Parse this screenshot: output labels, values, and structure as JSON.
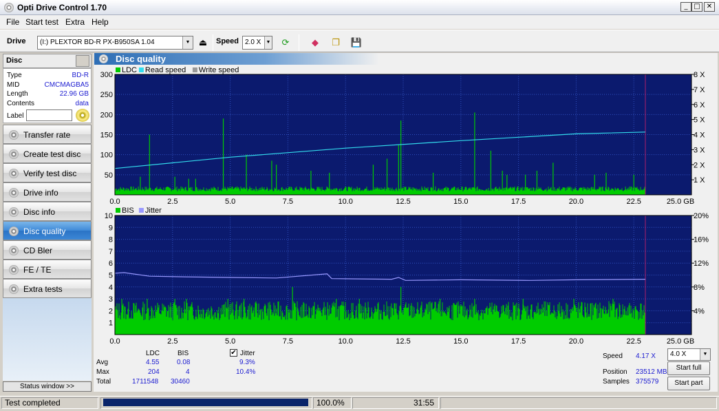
{
  "window": {
    "title": "Opti Drive Control 1.70",
    "min": "_",
    "max": "□",
    "close": "✕"
  },
  "menu": [
    "File",
    "Start test",
    "Extra",
    "Help"
  ],
  "toolbar": {
    "drive_label": "Drive",
    "drive_value": "(I:)   PLEXTOR BD-R  PX-B950SA 1.04",
    "speed_label": "Speed",
    "speed_value": "2.0 X"
  },
  "disc": {
    "title": "Disc",
    "type_k": "Type",
    "type_v": "BD-R",
    "mid_k": "MID",
    "mid_v": "CMCMAGBA5",
    "length_k": "Length",
    "length_v": "22.96 GB",
    "contents_k": "Contents",
    "contents_v": "data",
    "label_k": "Label",
    "label_v": ""
  },
  "nav": [
    {
      "label": "Transfer rate",
      "active": false
    },
    {
      "label": "Create test disc",
      "active": false
    },
    {
      "label": "Verify test disc",
      "active": false
    },
    {
      "label": "Drive info",
      "active": false
    },
    {
      "label": "Disc info",
      "active": false
    },
    {
      "label": "Disc quality",
      "active": true
    },
    {
      "label": "CD Bler",
      "active": false
    },
    {
      "label": "FE / TE",
      "active": false
    },
    {
      "label": "Extra tests",
      "active": false
    }
  ],
  "status_window_label": "Status window >>",
  "panel_title": "Disc quality",
  "colors": {
    "plot_bg": "#0b1a6e",
    "ldc": "#00cc00",
    "bis": "#00cc00",
    "read": "#33ddee",
    "jitter": "#9999ff",
    "marker": "#b0206a"
  },
  "chart_data": [
    {
      "type": "bar",
      "legend": [
        "LDC",
        "Read speed",
        "Write speed"
      ],
      "x_ticks": [
        "0.0",
        "2.5",
        "5.0",
        "7.5",
        "10.0",
        "12.5",
        "15.0",
        "17.5",
        "20.0",
        "22.5",
        "25.0 GB"
      ],
      "xlim": [
        0,
        25
      ],
      "y_left_ticks": [
        "300",
        "250",
        "200",
        "150",
        "100",
        "50"
      ],
      "ylim": [
        0,
        300
      ],
      "y_right_ticks": [
        "8 X",
        "7 X",
        "6 X",
        "5 X",
        "4 X",
        "3 X",
        "2 X",
        "1 X"
      ],
      "y2lim": [
        0,
        8
      ],
      "end_marker": 23.0,
      "ldc_baseline": 15,
      "ldc_spikes": [
        [
          1.1,
          45
        ],
        [
          1.5,
          150
        ],
        [
          2.6,
          45
        ],
        [
          3.2,
          40
        ],
        [
          3.5,
          40
        ],
        [
          4.7,
          190
        ],
        [
          5.7,
          100
        ],
        [
          6.8,
          85
        ],
        [
          7.0,
          75
        ],
        [
          8.5,
          60
        ],
        [
          9.3,
          55
        ],
        [
          11.2,
          75
        ],
        [
          11.8,
          90
        ],
        [
          12.3,
          125
        ],
        [
          12.4,
          185
        ],
        [
          13.8,
          55
        ],
        [
          15.6,
          205
        ],
        [
          16.3,
          110
        ],
        [
          16.8,
          60
        ],
        [
          17.0,
          50
        ],
        [
          17.8,
          50
        ],
        [
          18.3,
          60
        ],
        [
          19.0,
          80
        ],
        [
          20.8,
          50
        ],
        [
          21.3,
          55
        ],
        [
          22.5,
          50
        ]
      ],
      "read_speed": [
        [
          0,
          1.75
        ],
        [
          5,
          2.5
        ],
        [
          10,
          3.1
        ],
        [
          15,
          3.6
        ],
        [
          20,
          4.05
        ],
        [
          23.0,
          4.17
        ]
      ]
    },
    {
      "type": "bar",
      "legend": [
        "BIS",
        "Jitter"
      ],
      "x_ticks": [
        "0.0",
        "2.5",
        "5.0",
        "7.5",
        "10.0",
        "12.5",
        "15.0",
        "17.5",
        "20.0",
        "22.5",
        "25.0 GB"
      ],
      "xlim": [
        0,
        25
      ],
      "y_left_ticks": [
        "10",
        "9",
        "8",
        "7",
        "6",
        "5",
        "4",
        "3",
        "2",
        "1"
      ],
      "ylim": [
        0,
        10
      ],
      "y_right_ticks": [
        "20%",
        "16%",
        "12%",
        "8%",
        "4%"
      ],
      "y2lim": [
        0,
        20
      ],
      "end_marker": 23.0,
      "bis_baseline": 2,
      "bis_spikes": [
        [
          0.3,
          3
        ],
        [
          1.4,
          3
        ],
        [
          2.6,
          3
        ],
        [
          3.1,
          3
        ],
        [
          4.9,
          3
        ],
        [
          5.6,
          3
        ],
        [
          7.7,
          4
        ],
        [
          9.6,
          3
        ],
        [
          10.6,
          3
        ],
        [
          12.4,
          4
        ],
        [
          14.1,
          3
        ],
        [
          15.6,
          3
        ],
        [
          17.7,
          3
        ],
        [
          19.9,
          3
        ],
        [
          21.6,
          3
        ]
      ],
      "jitter": [
        [
          0,
          10.3
        ],
        [
          0.4,
          10.4
        ],
        [
          1.5,
          9.8
        ],
        [
          3,
          9.7
        ],
        [
          5,
          9.6
        ],
        [
          7,
          9.5
        ],
        [
          9.2,
          10.2
        ],
        [
          9.4,
          9.4
        ],
        [
          12,
          9.3
        ],
        [
          12.3,
          9.6
        ],
        [
          12.6,
          9.1
        ],
        [
          15,
          9.2
        ],
        [
          18,
          9.1
        ],
        [
          20,
          9.2
        ],
        [
          23.0,
          9.3
        ]
      ]
    }
  ],
  "stats": {
    "col_ldc": "LDC",
    "col_bis": "BIS",
    "jitter_label": "Jitter",
    "avg_k": "Avg",
    "avg_ldc": "4.55",
    "avg_bis": "0.08",
    "avg_jit": "9.3%",
    "max_k": "Max",
    "max_ldc": "204",
    "max_bis": "4",
    "max_jit": "10.4%",
    "total_k": "Total",
    "total_ldc": "1711548",
    "total_bis": "30460",
    "speed_k": "Speed",
    "speed_v": "4.17 X",
    "speed_select": "4.0 X",
    "position_k": "Position",
    "position_v": "23512 MB",
    "samples_k": "Samples",
    "samples_v": "375579",
    "start_full": "Start full",
    "start_part": "Start part"
  },
  "status": {
    "text": "Test completed",
    "progress": 1.0,
    "percent": "100.0%",
    "time": "31:55"
  }
}
